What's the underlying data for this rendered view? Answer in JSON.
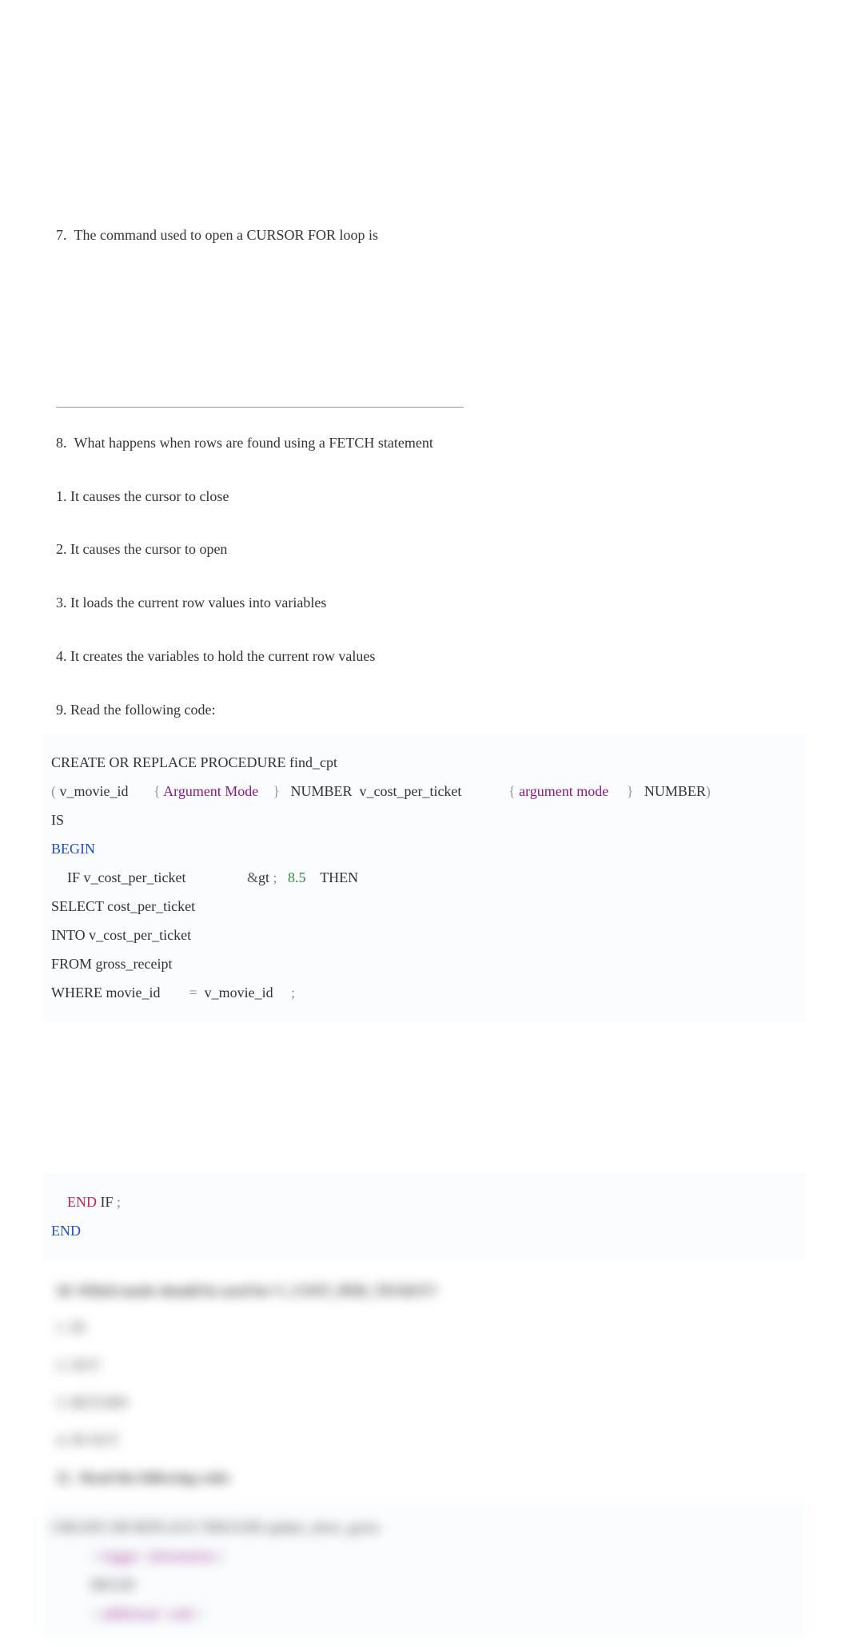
{
  "q7": {
    "text": "7.  The command used to open a CURSOR FOR loop is"
  },
  "q8": {
    "text": "8.  What happens when rows are found using a FETCH statement",
    "options": [
      "1. It causes the cursor to close",
      "2. It causes the cursor to open",
      "3. It loads the current row values into variables",
      "4. It creates the variables to hold the current row values"
    ]
  },
  "q9": {
    "intro": "9. Read the following code:",
    "code1": {
      "l1": "CREATE OR REPLACE PROCEDURE find_cpt",
      "l2_paren_open": "(",
      "l2_vmovie": " v_movie_id      ",
      "l2_brace_open": " {",
      "l2_argmode": " Argument Mode    ",
      "l2_brace_close": "}",
      "l2_num_v": "   NUMBER  v_cost_per_ticket            ",
      "l2_brace_open2": " {",
      "l2_argmode2": " argument mode     ",
      "l2_brace_close2": "}",
      "l2_number2": "   NUMBER",
      "l2_paren_close": ")",
      "l3": "IS",
      "l4": "BEGIN",
      "l5_if": "IF v_cost_per_ticket                ",
      "l5_amp": " &",
      "l5_gt": "gt",
      "l5_semi": " ;",
      "l5_num": "   8.5",
      "l5_then": "    THEN",
      "l6": "SELECT cost_per_ticket",
      "l7": "INTO v_cost_per_ticket",
      "l8": "FROM gross_receipt",
      "l9_a": "WHERE movie_id      ",
      "l9_eq": "  =  ",
      "l9_b": "v_movie_id",
      "l9_semi": "     ;"
    },
    "code2": {
      "l1_end": "END",
      "l1_if": " IF",
      "l1_semi": " ;",
      "l2": "END"
    }
  },
  "blur": {
    "q": "10. Which mode should be used for V_COST_PER_TICKET?",
    "opts": [
      "1. IN",
      "2. OUT",
      "3. RETURN",
      "4. IN OUT"
    ],
    "q11": "11.  Read the following code:",
    "codeA": "CREATE OR REPLACE TRIGGER update_show_gross",
    "codeB_brace": "{",
    "codeB_txt": " trigger  information",
    "codeB_brace2": " }",
    "codeC": "BEGIN",
    "codeD_brace": "{",
    "codeD_txt": " additional  code",
    "codeD_brace2": " }"
  }
}
